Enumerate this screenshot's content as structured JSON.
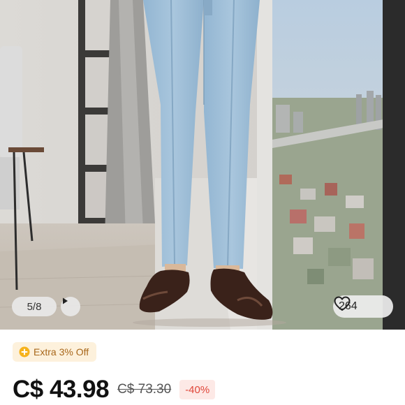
{
  "gallery": {
    "counter_text": "5/8",
    "play_icon": "play-icon",
    "like_icon": "heart-outline-icon",
    "like_count": "264"
  },
  "promo": {
    "icon": "coin-plus-icon",
    "label": "Extra 3% Off",
    "color": "#a8671a"
  },
  "pricing": {
    "current_price": "C$ 43.98",
    "original_price": "C$ 73.30",
    "discount": "-40%",
    "discount_color": "#e0473a"
  }
}
